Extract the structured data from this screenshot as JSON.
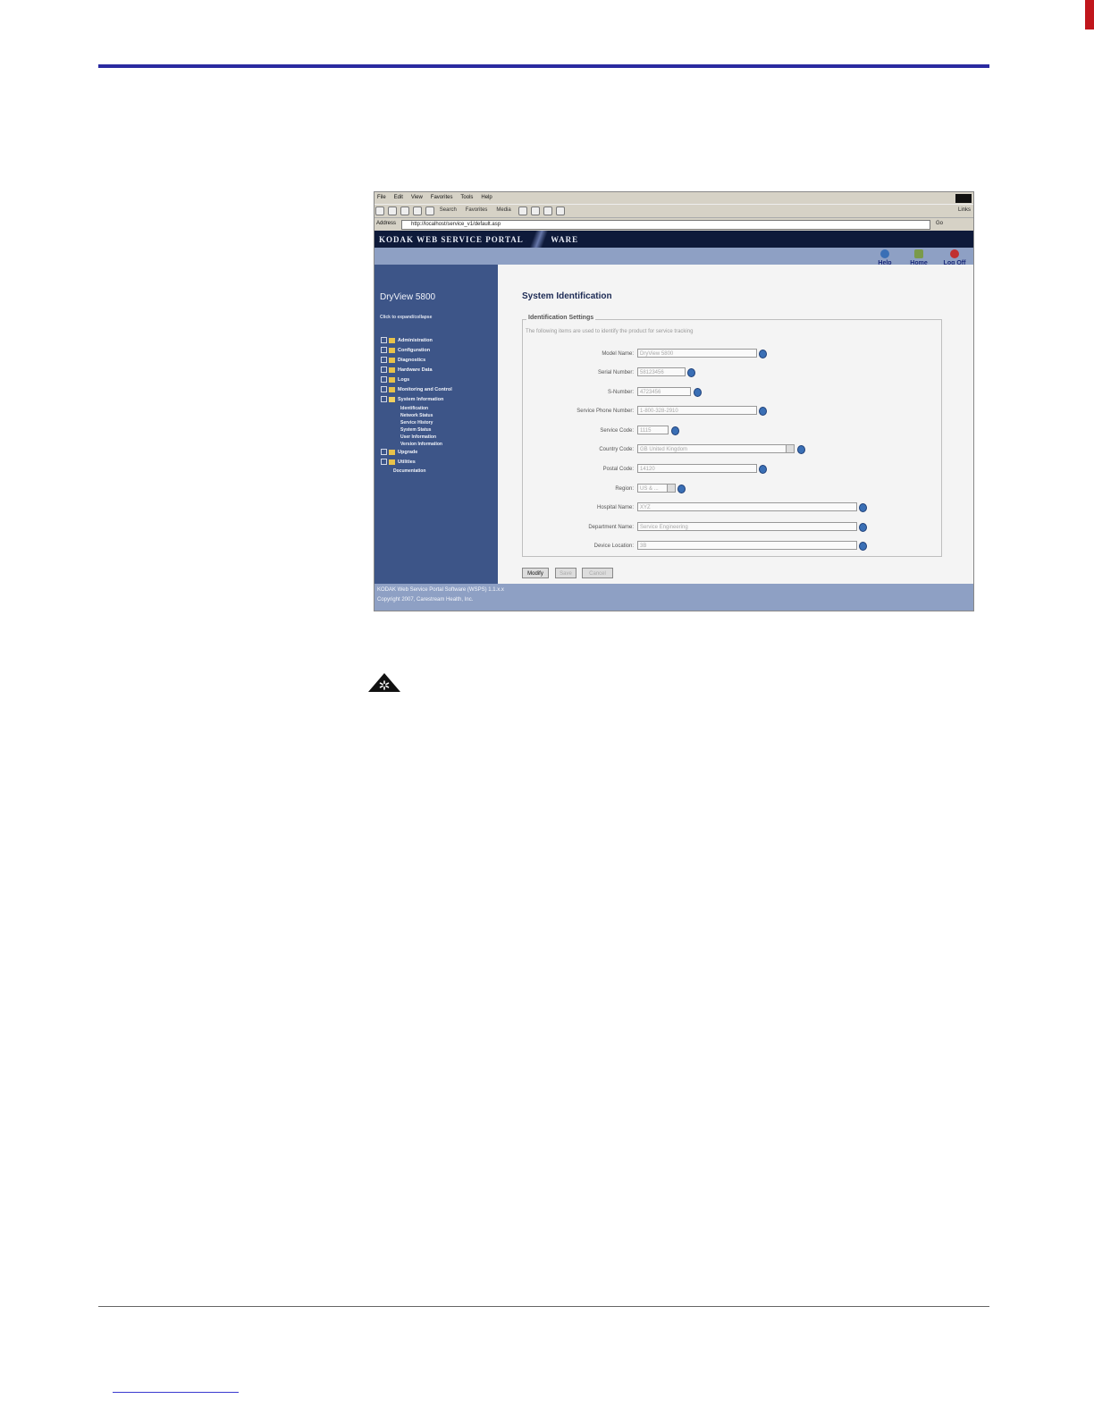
{
  "browser": {
    "menu": [
      "File",
      "Edit",
      "View",
      "Favorites",
      "Tools",
      "Help"
    ],
    "toolbar": [
      "Search",
      "Favorites",
      "Media"
    ],
    "links_label": "Links",
    "address_label": "Address",
    "address_value": "http://localhost/service_v1/default.asp",
    "go_label": "Go"
  },
  "banner": {
    "title": "KODAK WEB SERVICE PORTAL SOFTWARE"
  },
  "nav": {
    "help": "Help",
    "home": "Home",
    "logoff": "Log Off"
  },
  "sidebar": {
    "app_title": "DryView 5800",
    "expand_hint": "Click to expand/collapse",
    "tree": [
      "Administration",
      "Configuration",
      "Diagnostics",
      "Hardware Data",
      "Logs",
      "Monitoring and Control",
      "System Information"
    ],
    "system_info_children": [
      "Identification",
      "Network Status",
      "Service History",
      "System Status",
      "User Information",
      "Version Information"
    ],
    "tree_after": [
      "Upgrade",
      "Utilities"
    ],
    "documentation": "Documentation"
  },
  "main": {
    "title": "System Identification",
    "legend": "Identification Settings",
    "description": "The following items are used to identify the product for service tracking",
    "fields": [
      {
        "label": "Model Name:",
        "value": "DryView 5800"
      },
      {
        "label": "Serial Number:",
        "value": "58123456"
      },
      {
        "label": "S-Number:",
        "value": "4723456"
      },
      {
        "label": "Service Phone Number:",
        "value": "1-800-328-2910"
      },
      {
        "label": "Service Code:",
        "value": "1115"
      },
      {
        "label": "Country Code:",
        "value": "GB United Kingdom"
      },
      {
        "label": "Postal Code:",
        "value": "14120"
      },
      {
        "label": "Region:",
        "value": "US & ..."
      },
      {
        "label": "Hospital Name:",
        "value": "XYZ"
      },
      {
        "label": "Department Name:",
        "value": "Service Engineering"
      },
      {
        "label": "Device Location:",
        "value": "3B"
      }
    ],
    "buttons": {
      "modify": "Modify",
      "save": "Save",
      "cancel": "Cancel"
    }
  },
  "footer": {
    "line1": "KODAK Web Service Portal Software (WSPS) 1.1.x.x",
    "line2": "Copyright 2007, Carestream Health, Inc."
  },
  "colors": {
    "accent": "#2a2aa0",
    "sidebar": "#3d5588",
    "banner": "#0e1a3a"
  }
}
